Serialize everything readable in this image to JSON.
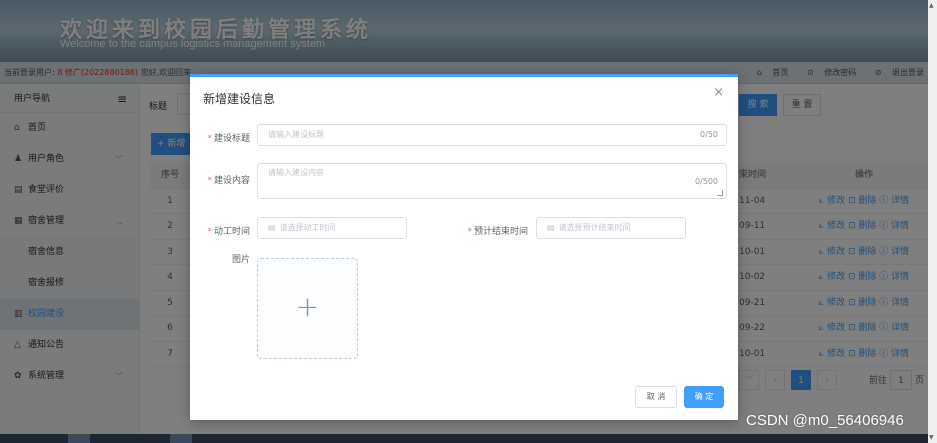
{
  "header": {
    "title_cn": "欢迎来到校园后勤管理系统",
    "title_en": "Welcome to the campus logistics management system"
  },
  "infobar": {
    "prefix": "当前登录用户: ",
    "user": "8 修广(2022880188)",
    "greeting": " 您好,欢迎回来",
    "links": [
      "首页",
      "修改密码",
      "退出登录"
    ]
  },
  "sidebar": {
    "title": "用户导航",
    "items": [
      {
        "label": "首页",
        "icon": "home-icon"
      },
      {
        "label": "用户角色",
        "icon": "user-icon"
      },
      {
        "label": "食堂评价",
        "icon": "document-icon"
      },
      {
        "label": "宿舍管理",
        "icon": "building-icon"
      },
      {
        "label": "宿舍信息",
        "icon": ""
      },
      {
        "label": "宿舍报修",
        "icon": ""
      },
      {
        "label": "校园建设",
        "icon": "chart-icon"
      },
      {
        "label": "通知公告",
        "icon": "bell-icon"
      },
      {
        "label": "系统管理",
        "icon": "gear-icon"
      }
    ]
  },
  "main": {
    "search_label": "标题",
    "search_button": "搜 索",
    "reset_button": "重 置",
    "add_button": "+ 新增",
    "table": {
      "headers": {
        "index": "序号",
        "time": "束时间",
        "ops": "操作"
      },
      "rows": [
        {
          "index": "1",
          "time": "11-04"
        },
        {
          "index": "2",
          "time": "09-11"
        },
        {
          "index": "3",
          "time": "10-01"
        },
        {
          "index": "4",
          "time": "10-02"
        },
        {
          "index": "5",
          "time": "09-21"
        },
        {
          "index": "6",
          "time": "09-22"
        },
        {
          "index": "7",
          "time": "10-01"
        }
      ],
      "ops": "⟀ 修改  ⊡ 删除  ⓘ 详情"
    },
    "pager": {
      "current": "1",
      "goto_label": "前往",
      "goto_value": "1",
      "goto_suffix": "页"
    }
  },
  "dialog": {
    "title": "新增建设信息",
    "fields": {
      "title_label": "建设标题",
      "title_placeholder": "请输入建设标题",
      "title_count": "0/50",
      "content_label": "建设内容",
      "content_placeholder": "请输入建设内容",
      "content_count": "0/500",
      "start_label": "动工时间",
      "start_placeholder": "请选择动工时间",
      "end_label": "预计结束时间",
      "end_placeholder": "请选择预计结束时间",
      "image_label": "图片"
    },
    "cancel": "取 消",
    "confirm": "确 定"
  },
  "watermark": "CSDN @m0_56406946",
  "colors": {
    "primary": "#409eff",
    "required": "#f56c6c"
  }
}
